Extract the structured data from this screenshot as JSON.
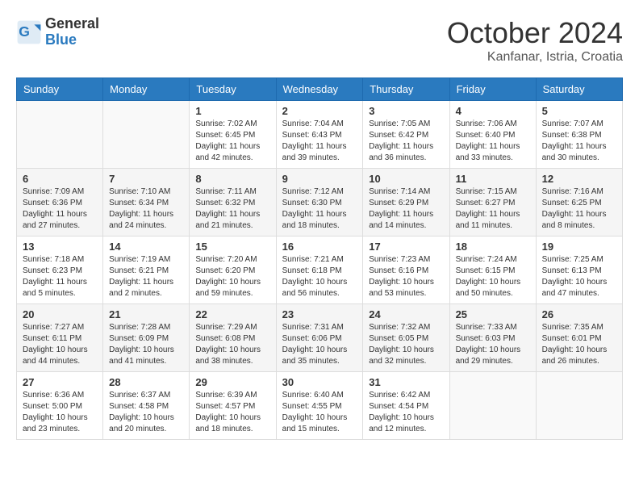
{
  "header": {
    "logo_line1": "General",
    "logo_line2": "Blue",
    "month": "October 2024",
    "location": "Kanfanar, Istria, Croatia"
  },
  "weekdays": [
    "Sunday",
    "Monday",
    "Tuesday",
    "Wednesday",
    "Thursday",
    "Friday",
    "Saturday"
  ],
  "weeks": [
    [
      {
        "day": "",
        "sunrise": "",
        "sunset": "",
        "daylight": ""
      },
      {
        "day": "",
        "sunrise": "",
        "sunset": "",
        "daylight": ""
      },
      {
        "day": "1",
        "sunrise": "Sunrise: 7:02 AM",
        "sunset": "Sunset: 6:45 PM",
        "daylight": "Daylight: 11 hours and 42 minutes."
      },
      {
        "day": "2",
        "sunrise": "Sunrise: 7:04 AM",
        "sunset": "Sunset: 6:43 PM",
        "daylight": "Daylight: 11 hours and 39 minutes."
      },
      {
        "day": "3",
        "sunrise": "Sunrise: 7:05 AM",
        "sunset": "Sunset: 6:42 PM",
        "daylight": "Daylight: 11 hours and 36 minutes."
      },
      {
        "day": "4",
        "sunrise": "Sunrise: 7:06 AM",
        "sunset": "Sunset: 6:40 PM",
        "daylight": "Daylight: 11 hours and 33 minutes."
      },
      {
        "day": "5",
        "sunrise": "Sunrise: 7:07 AM",
        "sunset": "Sunset: 6:38 PM",
        "daylight": "Daylight: 11 hours and 30 minutes."
      }
    ],
    [
      {
        "day": "6",
        "sunrise": "Sunrise: 7:09 AM",
        "sunset": "Sunset: 6:36 PM",
        "daylight": "Daylight: 11 hours and 27 minutes."
      },
      {
        "day": "7",
        "sunrise": "Sunrise: 7:10 AM",
        "sunset": "Sunset: 6:34 PM",
        "daylight": "Daylight: 11 hours and 24 minutes."
      },
      {
        "day": "8",
        "sunrise": "Sunrise: 7:11 AM",
        "sunset": "Sunset: 6:32 PM",
        "daylight": "Daylight: 11 hours and 21 minutes."
      },
      {
        "day": "9",
        "sunrise": "Sunrise: 7:12 AM",
        "sunset": "Sunset: 6:30 PM",
        "daylight": "Daylight: 11 hours and 18 minutes."
      },
      {
        "day": "10",
        "sunrise": "Sunrise: 7:14 AM",
        "sunset": "Sunset: 6:29 PM",
        "daylight": "Daylight: 11 hours and 14 minutes."
      },
      {
        "day": "11",
        "sunrise": "Sunrise: 7:15 AM",
        "sunset": "Sunset: 6:27 PM",
        "daylight": "Daylight: 11 hours and 11 minutes."
      },
      {
        "day": "12",
        "sunrise": "Sunrise: 7:16 AM",
        "sunset": "Sunset: 6:25 PM",
        "daylight": "Daylight: 11 hours and 8 minutes."
      }
    ],
    [
      {
        "day": "13",
        "sunrise": "Sunrise: 7:18 AM",
        "sunset": "Sunset: 6:23 PM",
        "daylight": "Daylight: 11 hours and 5 minutes."
      },
      {
        "day": "14",
        "sunrise": "Sunrise: 7:19 AM",
        "sunset": "Sunset: 6:21 PM",
        "daylight": "Daylight: 11 hours and 2 minutes."
      },
      {
        "day": "15",
        "sunrise": "Sunrise: 7:20 AM",
        "sunset": "Sunset: 6:20 PM",
        "daylight": "Daylight: 10 hours and 59 minutes."
      },
      {
        "day": "16",
        "sunrise": "Sunrise: 7:21 AM",
        "sunset": "Sunset: 6:18 PM",
        "daylight": "Daylight: 10 hours and 56 minutes."
      },
      {
        "day": "17",
        "sunrise": "Sunrise: 7:23 AM",
        "sunset": "Sunset: 6:16 PM",
        "daylight": "Daylight: 10 hours and 53 minutes."
      },
      {
        "day": "18",
        "sunrise": "Sunrise: 7:24 AM",
        "sunset": "Sunset: 6:15 PM",
        "daylight": "Daylight: 10 hours and 50 minutes."
      },
      {
        "day": "19",
        "sunrise": "Sunrise: 7:25 AM",
        "sunset": "Sunset: 6:13 PM",
        "daylight": "Daylight: 10 hours and 47 minutes."
      }
    ],
    [
      {
        "day": "20",
        "sunrise": "Sunrise: 7:27 AM",
        "sunset": "Sunset: 6:11 PM",
        "daylight": "Daylight: 10 hours and 44 minutes."
      },
      {
        "day": "21",
        "sunrise": "Sunrise: 7:28 AM",
        "sunset": "Sunset: 6:09 PM",
        "daylight": "Daylight: 10 hours and 41 minutes."
      },
      {
        "day": "22",
        "sunrise": "Sunrise: 7:29 AM",
        "sunset": "Sunset: 6:08 PM",
        "daylight": "Daylight: 10 hours and 38 minutes."
      },
      {
        "day": "23",
        "sunrise": "Sunrise: 7:31 AM",
        "sunset": "Sunset: 6:06 PM",
        "daylight": "Daylight: 10 hours and 35 minutes."
      },
      {
        "day": "24",
        "sunrise": "Sunrise: 7:32 AM",
        "sunset": "Sunset: 6:05 PM",
        "daylight": "Daylight: 10 hours and 32 minutes."
      },
      {
        "day": "25",
        "sunrise": "Sunrise: 7:33 AM",
        "sunset": "Sunset: 6:03 PM",
        "daylight": "Daylight: 10 hours and 29 minutes."
      },
      {
        "day": "26",
        "sunrise": "Sunrise: 7:35 AM",
        "sunset": "Sunset: 6:01 PM",
        "daylight": "Daylight: 10 hours and 26 minutes."
      }
    ],
    [
      {
        "day": "27",
        "sunrise": "Sunrise: 6:36 AM",
        "sunset": "Sunset: 5:00 PM",
        "daylight": "Daylight: 10 hours and 23 minutes."
      },
      {
        "day": "28",
        "sunrise": "Sunrise: 6:37 AM",
        "sunset": "Sunset: 4:58 PM",
        "daylight": "Daylight: 10 hours and 20 minutes."
      },
      {
        "day": "29",
        "sunrise": "Sunrise: 6:39 AM",
        "sunset": "Sunset: 4:57 PM",
        "daylight": "Daylight: 10 hours and 18 minutes."
      },
      {
        "day": "30",
        "sunrise": "Sunrise: 6:40 AM",
        "sunset": "Sunset: 4:55 PM",
        "daylight": "Daylight: 10 hours and 15 minutes."
      },
      {
        "day": "31",
        "sunrise": "Sunrise: 6:42 AM",
        "sunset": "Sunset: 4:54 PM",
        "daylight": "Daylight: 10 hours and 12 minutes."
      },
      {
        "day": "",
        "sunrise": "",
        "sunset": "",
        "daylight": ""
      },
      {
        "day": "",
        "sunrise": "",
        "sunset": "",
        "daylight": ""
      }
    ]
  ]
}
